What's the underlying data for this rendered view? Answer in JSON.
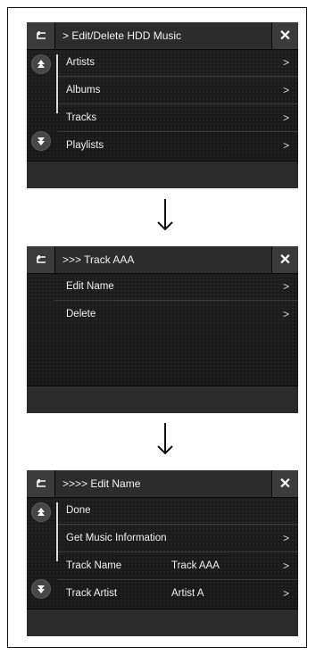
{
  "screens": [
    {
      "title": "> Edit/Delete HDD Music",
      "items": [
        {
          "label": "Artists",
          "value": "",
          "chevron": ">"
        },
        {
          "label": "Albums",
          "value": "",
          "chevron": ">"
        },
        {
          "label": "Tracks",
          "value": "",
          "chevron": ">"
        },
        {
          "label": "Playlists",
          "value": "",
          "chevron": ">"
        }
      ]
    },
    {
      "title": ">>> Track AAA",
      "items": [
        {
          "label": "Edit Name",
          "value": "",
          "chevron": ">"
        },
        {
          "label": "Delete",
          "value": "",
          "chevron": ">"
        }
      ]
    },
    {
      "title": ">>>> Edit Name",
      "items": [
        {
          "label": "Done",
          "value": "",
          "chevron": ""
        },
        {
          "label": "Get Music Information",
          "value": "",
          "chevron": ">"
        },
        {
          "label": "Track Name",
          "value": "Track AAA",
          "chevron": ">"
        },
        {
          "label": "Track Artist",
          "value": "Artist A",
          "chevron": ">"
        }
      ]
    }
  ],
  "icons": {
    "back": "back-arrow-icon",
    "close": "close-icon",
    "scroll_up": "scroll-up-icon",
    "scroll_down": "scroll-down-icon",
    "flow": "down-arrow-icon"
  },
  "close_symbol": "✕"
}
